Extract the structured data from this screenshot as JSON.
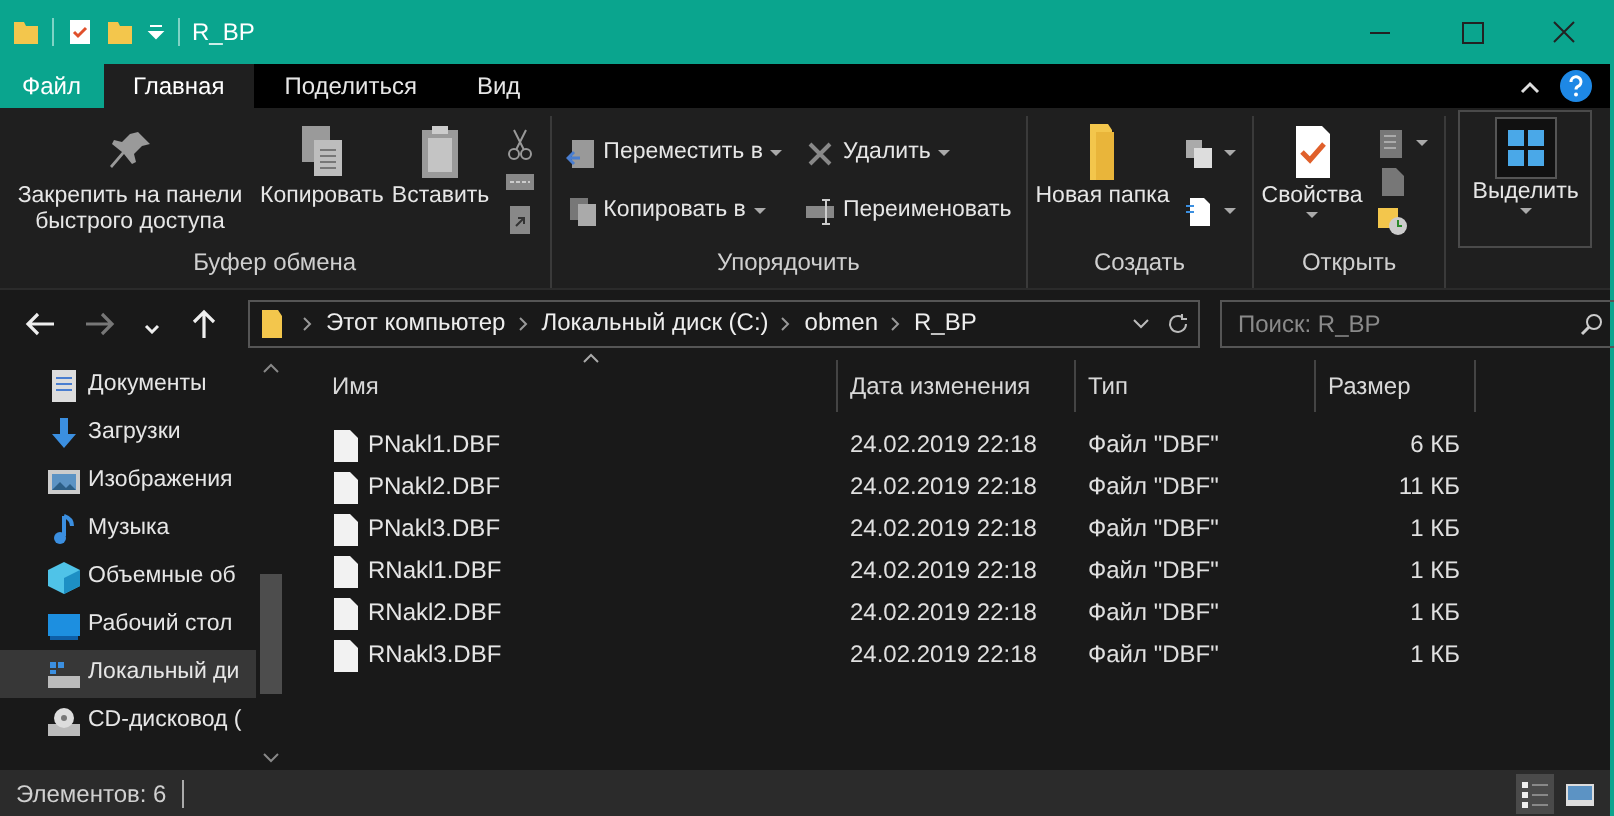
{
  "window": {
    "title": "R_BP"
  },
  "ribbon_tabs": [
    {
      "label": "Файл",
      "selected": false,
      "kind": "file"
    },
    {
      "label": "Главная",
      "selected": true,
      "kind": "tab"
    },
    {
      "label": "Поделиться",
      "selected": false,
      "kind": "tab"
    },
    {
      "label": "Вид",
      "selected": false,
      "kind": "tab"
    }
  ],
  "ribbon_groups": [
    {
      "label": "Буфер обмена",
      "items": [
        {
          "kind": "large",
          "label": "Закрепить на панели быстрого доступа",
          "dropdown": false
        },
        {
          "kind": "large",
          "label": "Копировать",
          "dropdown": false
        },
        {
          "kind": "large",
          "label": "Вставить",
          "dropdown": false
        },
        {
          "kind": "stack",
          "items": [
            {
              "dropdown": false
            },
            {
              "dropdown": false
            },
            {
              "dropdown": false
            }
          ]
        }
      ]
    },
    {
      "label": "Упорядочить",
      "items": [
        {
          "kind": "stack",
          "items": [
            {
              "label": "Переместить в",
              "dropdown": true
            },
            {
              "label": "Копировать в",
              "dropdown": true
            }
          ]
        },
        {
          "kind": "stack",
          "items": [
            {
              "label": "Удалить",
              "dropdown": true
            },
            {
              "label": "Переименовать",
              "dropdown": false
            }
          ]
        }
      ]
    },
    {
      "label": "Создать",
      "items": [
        {
          "kind": "large",
          "label": "Новая папка",
          "dropdown": false
        },
        {
          "kind": "stack",
          "items": [
            {
              "dropdown": true
            },
            {
              "dropdown": true
            }
          ]
        }
      ]
    },
    {
      "label": "Открыть",
      "items": [
        {
          "kind": "large",
          "label": "Свойства",
          "dropdown": true
        },
        {
          "kind": "stack",
          "items": [
            {
              "dropdown": true
            },
            {
              "dropdown": false
            },
            {
              "dropdown": false
            }
          ]
        }
      ]
    },
    {
      "items": [
        {
          "kind": "large",
          "label": "Выделить",
          "dropdown": true
        }
      ]
    }
  ],
  "nav_buttons": [
    {
      "kind": "back",
      "disabled": false
    },
    {
      "kind": "forward",
      "disabled": true
    },
    {
      "kind": "recent",
      "disabled": false
    },
    {
      "kind": "up",
      "disabled": false
    }
  ],
  "address": {
    "crumbs": [
      "Этот компьютер",
      "Локальный диск (C:)",
      "obmen",
      "R_BP"
    ]
  },
  "search": {
    "placeholder": "Поиск: R_BP"
  },
  "sidebar": {
    "items": [
      {
        "label": "Документы",
        "selected": false
      },
      {
        "label": "Загрузки",
        "selected": false
      },
      {
        "label": "Изображения",
        "selected": false
      },
      {
        "label": "Музыка",
        "selected": false
      },
      {
        "label": "Объемные об",
        "selected": false
      },
      {
        "label": "Рабочий стол",
        "selected": false
      },
      {
        "label": "Локальный ди",
        "selected": true
      },
      {
        "label": "CD-дисковод (",
        "selected": false
      }
    ]
  },
  "table": {
    "columns": [
      {
        "label": "Имя",
        "sorted": true
      },
      {
        "label": "Дата изменения",
        "sorted": false
      },
      {
        "label": "Тип",
        "sorted": false
      },
      {
        "label": "Размер",
        "sorted": false
      }
    ],
    "rows": [
      {
        "name": "PNakl1.DBF",
        "date": "24.02.2019 22:18",
        "type": "Файл \"DBF\"",
        "size": "6 КБ"
      },
      {
        "name": "PNakl2.DBF",
        "date": "24.02.2019 22:18",
        "type": "Файл \"DBF\"",
        "size": "11 КБ"
      },
      {
        "name": "PNakl3.DBF",
        "date": "24.02.2019 22:18",
        "type": "Файл \"DBF\"",
        "size": "1 КБ"
      },
      {
        "name": "RNakl1.DBF",
        "date": "24.02.2019 22:18",
        "type": "Файл \"DBF\"",
        "size": "1 КБ"
      },
      {
        "name": "RNakl2.DBF",
        "date": "24.02.2019 22:18",
        "type": "Файл \"DBF\"",
        "size": "1 КБ"
      },
      {
        "name": "RNakl3.DBF",
        "date": "24.02.2019 22:18",
        "type": "Файл \"DBF\"",
        "size": "1 КБ"
      }
    ]
  },
  "status_bar": {
    "text": "Элементов: 6",
    "views": [
      {
        "kind": "details",
        "selected": true
      },
      {
        "kind": "large-icons",
        "selected": false
      }
    ]
  }
}
